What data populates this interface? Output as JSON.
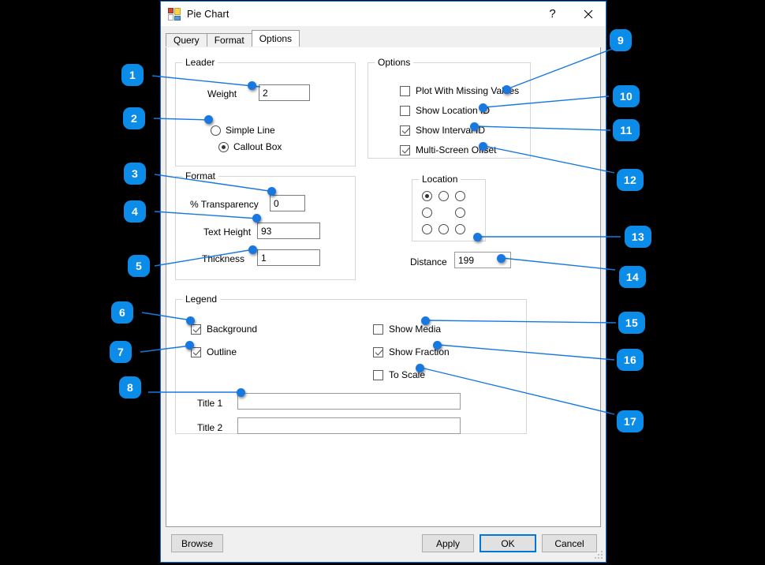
{
  "window": {
    "title": "Pie Chart",
    "icon": "form-designer-icon",
    "help_label": "?",
    "close_label": "✕"
  },
  "tabs": [
    {
      "label": "Query",
      "active": false
    },
    {
      "label": "Format",
      "active": false
    },
    {
      "label": "Options",
      "active": true
    }
  ],
  "leader": {
    "title": "Leader",
    "weight_label": "Weight",
    "weight_value": "2",
    "radios": [
      {
        "label": "Simple Line",
        "checked": false
      },
      {
        "label": "Callout Box",
        "checked": true
      }
    ]
  },
  "format": {
    "title": "Format",
    "transparency_label": "% Transparency",
    "transparency_value": "0",
    "text_height_label": "Text Height",
    "text_height_value": "93",
    "thickness_label": "Thickness",
    "thickness_value": "1"
  },
  "options": {
    "title": "Options",
    "checkboxes": [
      {
        "label": "Plot With Missing Values",
        "checked": false
      },
      {
        "label": "Show Location ID",
        "checked": false
      },
      {
        "label": "Show Interval ID",
        "checked": true
      },
      {
        "label": "Multi-Screen Offset",
        "checked": true
      }
    ]
  },
  "location": {
    "title": "Location",
    "cells": [
      {
        "pos": "top-left",
        "checked": true
      },
      {
        "pos": "top-center",
        "checked": false
      },
      {
        "pos": "top-right",
        "checked": false
      },
      {
        "pos": "middle-left",
        "checked": false
      },
      {
        "pos": "middle-right",
        "checked": false
      },
      {
        "pos": "bottom-left",
        "checked": false
      },
      {
        "pos": "bottom-center",
        "checked": false
      },
      {
        "pos": "bottom-right",
        "checked": false
      }
    ],
    "distance_label": "Distance",
    "distance_value": "199"
  },
  "legend": {
    "title": "Legend",
    "left_checkboxes": [
      {
        "label": "Background",
        "checked": true
      },
      {
        "label": "Outline",
        "checked": true
      }
    ],
    "right_checkboxes": [
      {
        "label": "Show Media",
        "checked": false
      },
      {
        "label": "Show Fraction",
        "checked": true
      },
      {
        "label": "To Scale",
        "checked": false
      }
    ],
    "title1_label": "Title 1",
    "title1_value": "",
    "title2_label": "Title 2",
    "title2_value": ""
  },
  "buttons": {
    "browse": "Browse",
    "apply": "Apply",
    "ok": "OK",
    "cancel": "Cancel"
  },
  "annotations": {
    "accent_color": "#0c8ce9",
    "line_color": "#1878e0",
    "badges": [
      {
        "n": "1"
      },
      {
        "n": "2"
      },
      {
        "n": "3"
      },
      {
        "n": "4"
      },
      {
        "n": "5"
      },
      {
        "n": "6"
      },
      {
        "n": "7"
      },
      {
        "n": "8"
      },
      {
        "n": "9"
      },
      {
        "n": "10"
      },
      {
        "n": "11"
      },
      {
        "n": "12"
      },
      {
        "n": "13"
      },
      {
        "n": "14"
      },
      {
        "n": "15"
      },
      {
        "n": "16"
      },
      {
        "n": "17"
      }
    ]
  }
}
